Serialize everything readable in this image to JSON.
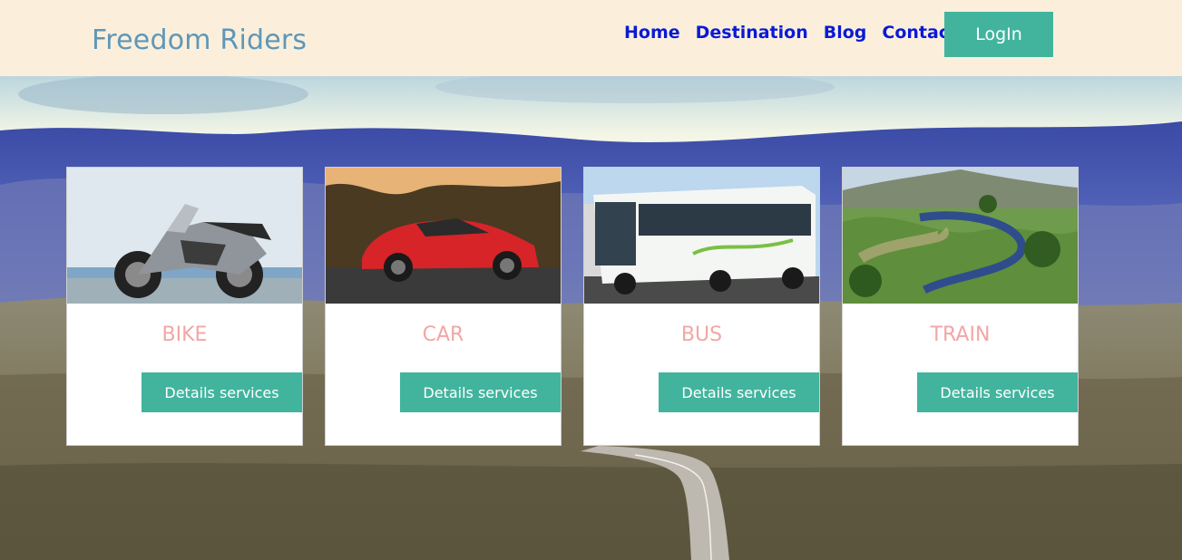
{
  "header": {
    "brand": "Freedom Riders",
    "nav": [
      "Home",
      "Destination",
      "Blog",
      "Contact"
    ],
    "login_label": "LogIn"
  },
  "cards": [
    {
      "title": "BIKE",
      "button_label": "Details services",
      "image": "motorcycle-image"
    },
    {
      "title": "CAR",
      "button_label": "Details services",
      "image": "car-image"
    },
    {
      "title": "BUS",
      "button_label": "Details services",
      "image": "bus-image"
    },
    {
      "title": "TRAIN",
      "button_label": "Details services",
      "image": "train-image"
    }
  ],
  "colors": {
    "header_bg": "#fbefdc",
    "brand": "#5e97b8",
    "nav_link": "#0a1ad6",
    "accent": "#42b49e",
    "card_title": "#f2a6a6"
  }
}
